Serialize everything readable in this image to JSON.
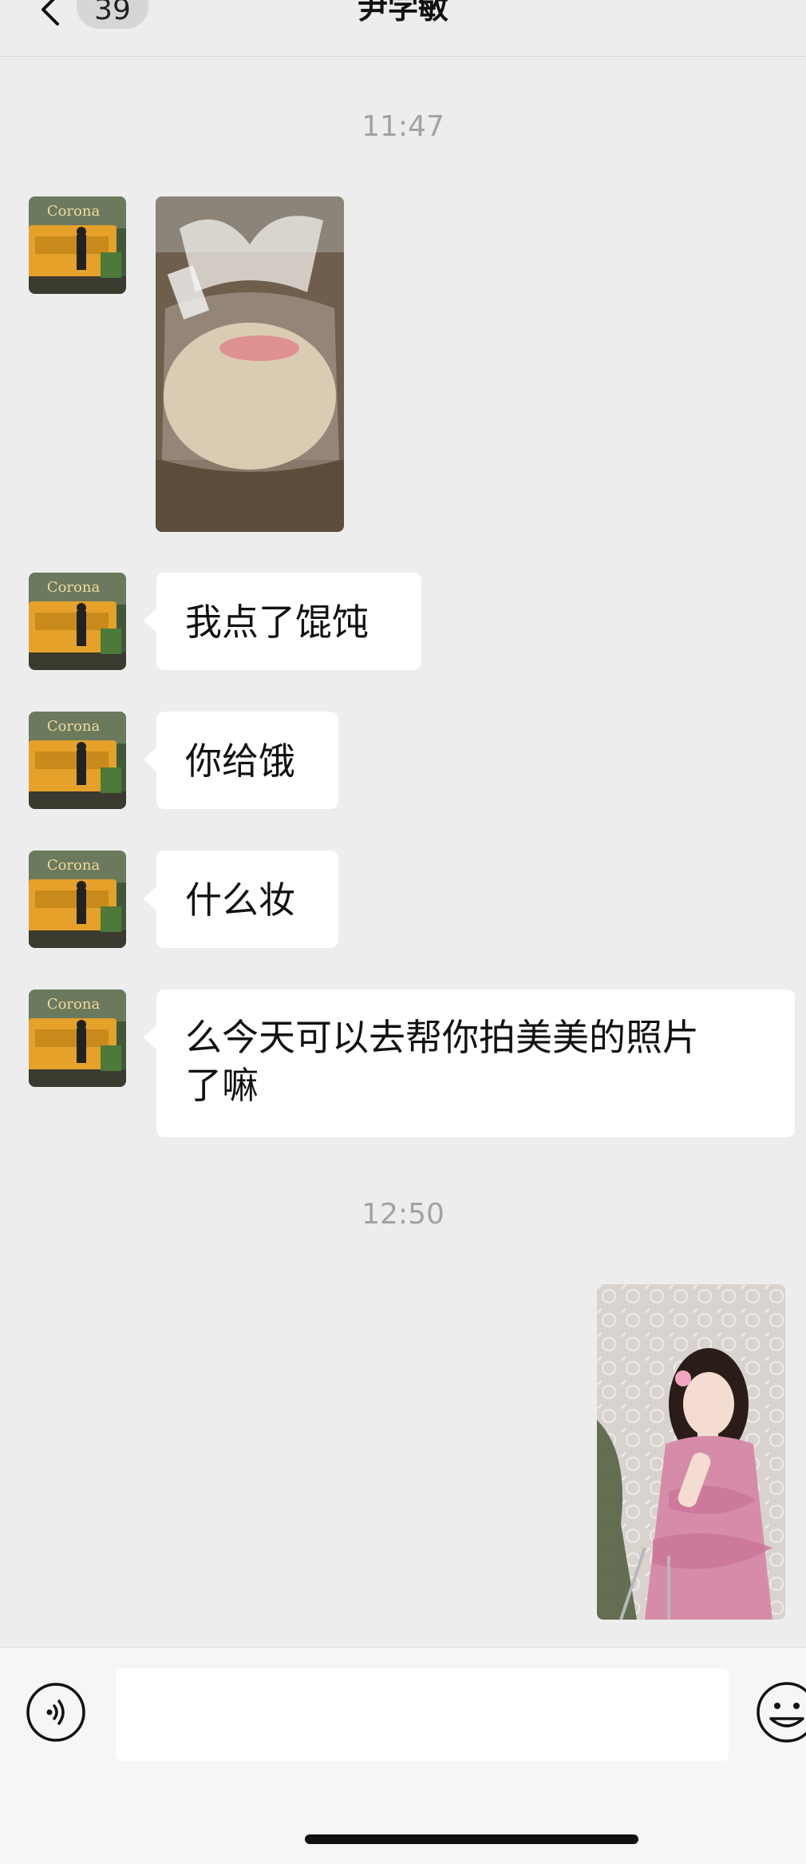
{
  "header": {
    "back_icon": "chevron-left-icon",
    "unread_count": "39",
    "title": "尹学敏"
  },
  "messages": [
    {
      "type": "timestamp",
      "text": "11:47"
    },
    {
      "type": "image",
      "sender": "contact",
      "image_desc": "food-in-plastic-bag"
    },
    {
      "type": "text",
      "sender": "contact",
      "text": "我点了馄饨"
    },
    {
      "type": "text",
      "sender": "contact",
      "text": "你给饿"
    },
    {
      "type": "text",
      "sender": "contact",
      "text": "什么妆"
    },
    {
      "type": "text",
      "sender": "contact",
      "text_line1": "么今天可以去帮你拍美美的照片",
      "text_line2": "了嘛"
    },
    {
      "type": "timestamp",
      "text": "12:50"
    },
    {
      "type": "image",
      "sender": "self",
      "image_desc": "girl-in-pink-dress"
    }
  ],
  "input_bar": {
    "voice_icon": "voice-input-icon",
    "text_value": "",
    "emoji_icon": "emoji-icon"
  },
  "colors": {
    "background": "#ededed",
    "bubble": "#ffffff",
    "timestamp": "#a2a2a2",
    "input_bar": "#f6f6f6"
  }
}
